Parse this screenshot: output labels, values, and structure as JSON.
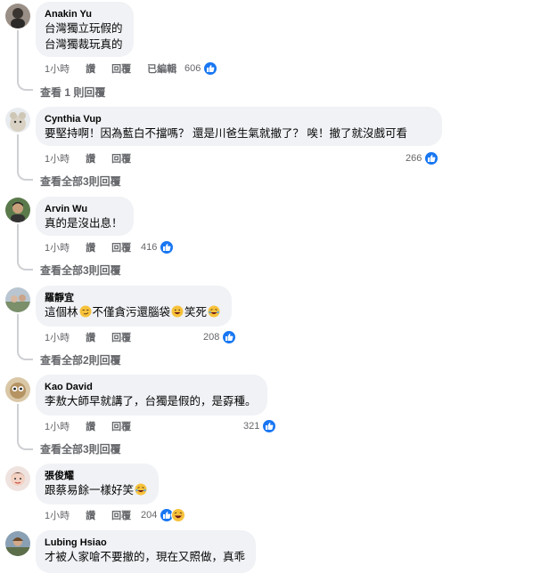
{
  "comments": [
    {
      "author": "Anakin Yu",
      "lines": [
        "台灣獨立玩假的",
        "台灣獨裁玩真的"
      ],
      "time": "1小時",
      "like": "讚",
      "reply": "回覆",
      "edited": "已編輯",
      "count": "606",
      "view_replies": "查看 1 則回覆"
    },
    {
      "author": "Cynthia Vup",
      "lines": [
        "要堅持啊！因為藍白不擋嗎？ 還是川爸生氣就撤了？ 唉！撤了就沒戲可看"
      ],
      "time": "1小時",
      "like": "讚",
      "reply": "回覆",
      "count": "266",
      "view_replies": "查看全部3則回覆"
    },
    {
      "author": "Arvin Wu",
      "lines": [
        "真的是沒出息！"
      ],
      "time": "1小時",
      "like": "讚",
      "reply": "回覆",
      "count": "416",
      "view_replies": "查看全部3則回覆"
    },
    {
      "author": "羅靜宜",
      "text_a": "這個林",
      "text_b": "不僅貪污還腦袋",
      "text_c": "笑死",
      "time": "1小時",
      "like": "讚",
      "reply": "回覆",
      "count": "208",
      "view_replies": "查看全部2則回覆"
    },
    {
      "author": "Kao David",
      "lines": [
        "李敖大師早就講了，台獨是假的，是孬種。"
      ],
      "time": "1小時",
      "like": "讚",
      "reply": "回覆",
      "count": "321",
      "view_replies": "查看全部3則回覆"
    },
    {
      "author": "張俊耀",
      "text_a": "跟蔡易餘一樣好笑",
      "time": "1小時",
      "like": "讚",
      "reply": "回覆",
      "count": "204"
    },
    {
      "author": "Lubing Hsiao",
      "lines": [
        "才被人家嗆不要撤的，現在又照做，真乖"
      ]
    }
  ],
  "colors": {
    "like_blue": "#1877f2",
    "bubble": "#f0f2f5",
    "meta": "#65676b",
    "thread": "#ced0d4"
  },
  "icons": [
    "like-icon",
    "haha-icon",
    "smirk-emoji",
    "grin-emoji",
    "laugh-cry-emoji"
  ]
}
